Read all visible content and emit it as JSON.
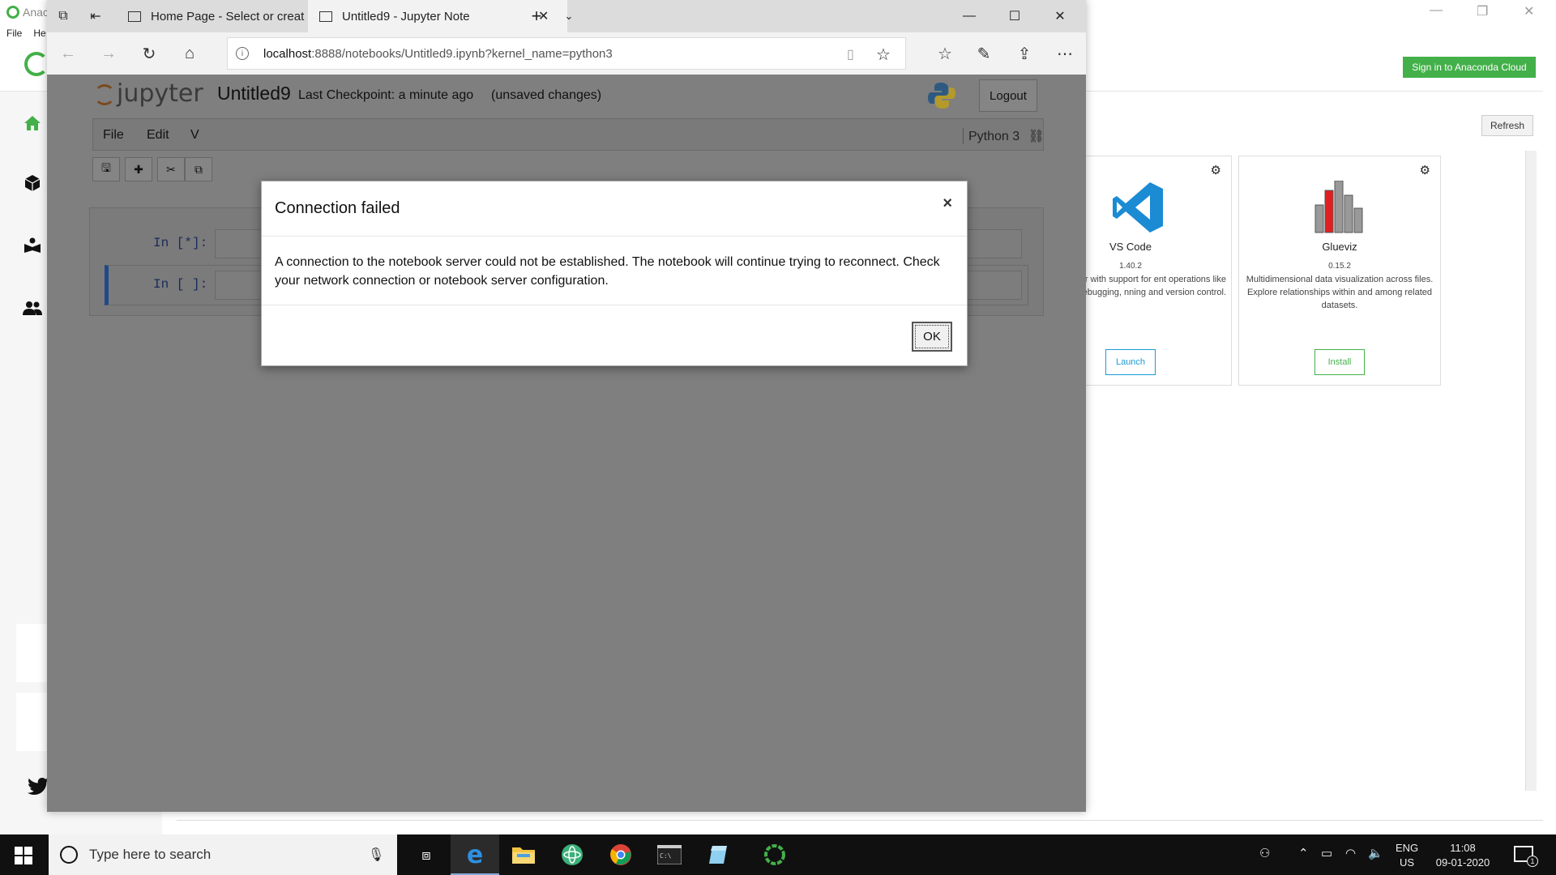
{
  "anaconda": {
    "title": "Anac",
    "menu": [
      "File",
      "He"
    ],
    "sign_in_label": "Sign in to Anaconda Cloud",
    "refresh_label": "Refresh",
    "apps": [
      {
        "name": "VS Code",
        "version": "1.40.2",
        "description": "d code editor with support for ent operations like debugging, nning and version control.",
        "action": "Launch",
        "action_color": "#1a9bd7"
      },
      {
        "name": "Glueviz",
        "version": "0.15.2",
        "description": "Multidimensional data visualization across files. Explore relationships within and among related datasets.",
        "action": "Install",
        "action_color": "#43b049"
      }
    ],
    "brand_color": "#43b049"
  },
  "browser": {
    "tabs": [
      {
        "label": "Home Page - Select or creat"
      },
      {
        "label": "Untitled9 - Jupyter Note"
      }
    ],
    "url_host": "localhost",
    "url_rest": ":8888/notebooks/Untitled9.ipynb?kernel_name=python3"
  },
  "jupyter": {
    "logo_text": "jupyter",
    "notebook_name": "Untitled9",
    "checkpoint": "Last Checkpoint: a minute ago",
    "save_status": "(unsaved changes)",
    "logout_label": "Logout",
    "menu": [
      "File",
      "Edit",
      "V"
    ],
    "kernel_name": "Python 3",
    "cells": [
      {
        "prompt": "In [*]:"
      },
      {
        "prompt": "In [ ]:"
      }
    ]
  },
  "modal": {
    "title": "Connection failed",
    "close_glyph": "×",
    "body": "A connection to the notebook server could not be established. The notebook will continue trying to reconnect. Check your network connection or notebook server configuration.",
    "ok_label": "OK"
  },
  "taskbar": {
    "search_placeholder": "Type here to search",
    "lang_line1": "ENG",
    "lang_line2": "US",
    "time": "11:08",
    "date": "09-01-2020",
    "notification_count": "1"
  }
}
